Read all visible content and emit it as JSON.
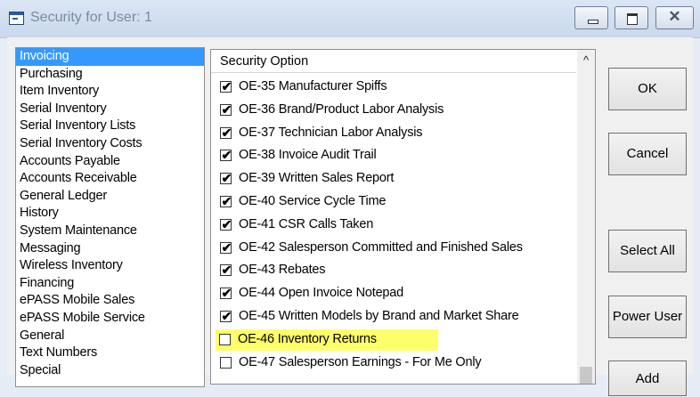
{
  "window": {
    "title": "Security for User: 1",
    "controls": {
      "minimize": "minimize",
      "maximize": "maximize",
      "close": "✕"
    }
  },
  "categories": [
    {
      "label": "Invoicing",
      "selected": true
    },
    {
      "label": "Purchasing"
    },
    {
      "label": "Item Inventory"
    },
    {
      "label": "Serial Inventory"
    },
    {
      "label": "Serial Inventory Lists"
    },
    {
      "label": "Serial Inventory Costs"
    },
    {
      "label": "Accounts Payable"
    },
    {
      "label": "Accounts Receivable"
    },
    {
      "label": "General Ledger"
    },
    {
      "label": "History"
    },
    {
      "label": "System Maintenance"
    },
    {
      "label": "Messaging"
    },
    {
      "label": "Wireless Inventory"
    },
    {
      "label": "Financing"
    },
    {
      "label": "ePASS Mobile Sales"
    },
    {
      "label": "ePASS Mobile Service"
    },
    {
      "label": "General"
    },
    {
      "label": "Text Numbers"
    },
    {
      "label": "Special"
    }
  ],
  "security_options": {
    "header": "Security Option",
    "scroll_up_glyph": "^",
    "items": [
      {
        "label": "OE-35 Manufacturer Spiffs",
        "checked": true
      },
      {
        "label": "OE-36 Brand/Product Labor Analysis",
        "checked": true
      },
      {
        "label": "OE-37 Technician Labor Analysis",
        "checked": true
      },
      {
        "label": "OE-38 Invoice Audit Trail",
        "checked": true
      },
      {
        "label": "OE-39 Written Sales Report",
        "checked": true
      },
      {
        "label": "OE-40 Service Cycle Time",
        "checked": true
      },
      {
        "label": "OE-41 CSR Calls Taken",
        "checked": true
      },
      {
        "label": "OE-42 Salesperson Committed and Finished Sales",
        "checked": true
      },
      {
        "label": "OE-43 Rebates",
        "checked": true
      },
      {
        "label": "OE-44 Open Invoice Notepad",
        "checked": true
      },
      {
        "label": "OE-45 Written Models by Brand and Market Share",
        "checked": true
      },
      {
        "label": "OE-46 Inventory Returns",
        "checked": false,
        "highlighted": true
      },
      {
        "label": "OE-47 Salesperson Earnings - For Me Only",
        "checked": false
      }
    ]
  },
  "buttons": {
    "ok": "OK",
    "cancel": "Cancel",
    "select_all": "Select All",
    "power_user": "Power User",
    "add": "Add"
  },
  "colors": {
    "selection": "#3399ff",
    "highlight": "#ffff6b"
  }
}
